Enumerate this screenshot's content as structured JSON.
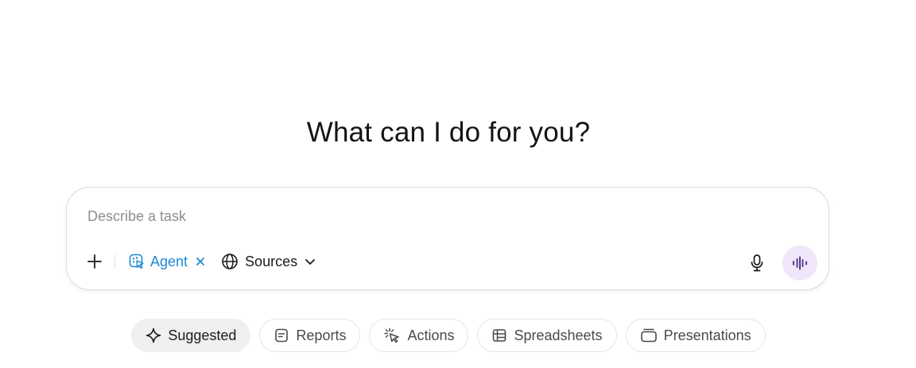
{
  "headline": "What can I do for you?",
  "composer": {
    "placeholder": "Describe a task",
    "agent_label": "Agent",
    "sources_label": "Sources"
  },
  "chips": [
    {
      "label": "Suggested",
      "icon": "sparkle-icon",
      "active": true
    },
    {
      "label": "Reports",
      "icon": "document-icon",
      "active": false
    },
    {
      "label": "Actions",
      "icon": "cursor-click-icon",
      "active": false
    },
    {
      "label": "Spreadsheets",
      "icon": "table-icon",
      "active": false
    },
    {
      "label": "Presentations",
      "icon": "slides-icon",
      "active": false
    }
  ],
  "colors": {
    "agent_accent": "#1e88d6",
    "voice_button_bg": "#efe6fb",
    "voice_icon": "#5b3a8c"
  }
}
